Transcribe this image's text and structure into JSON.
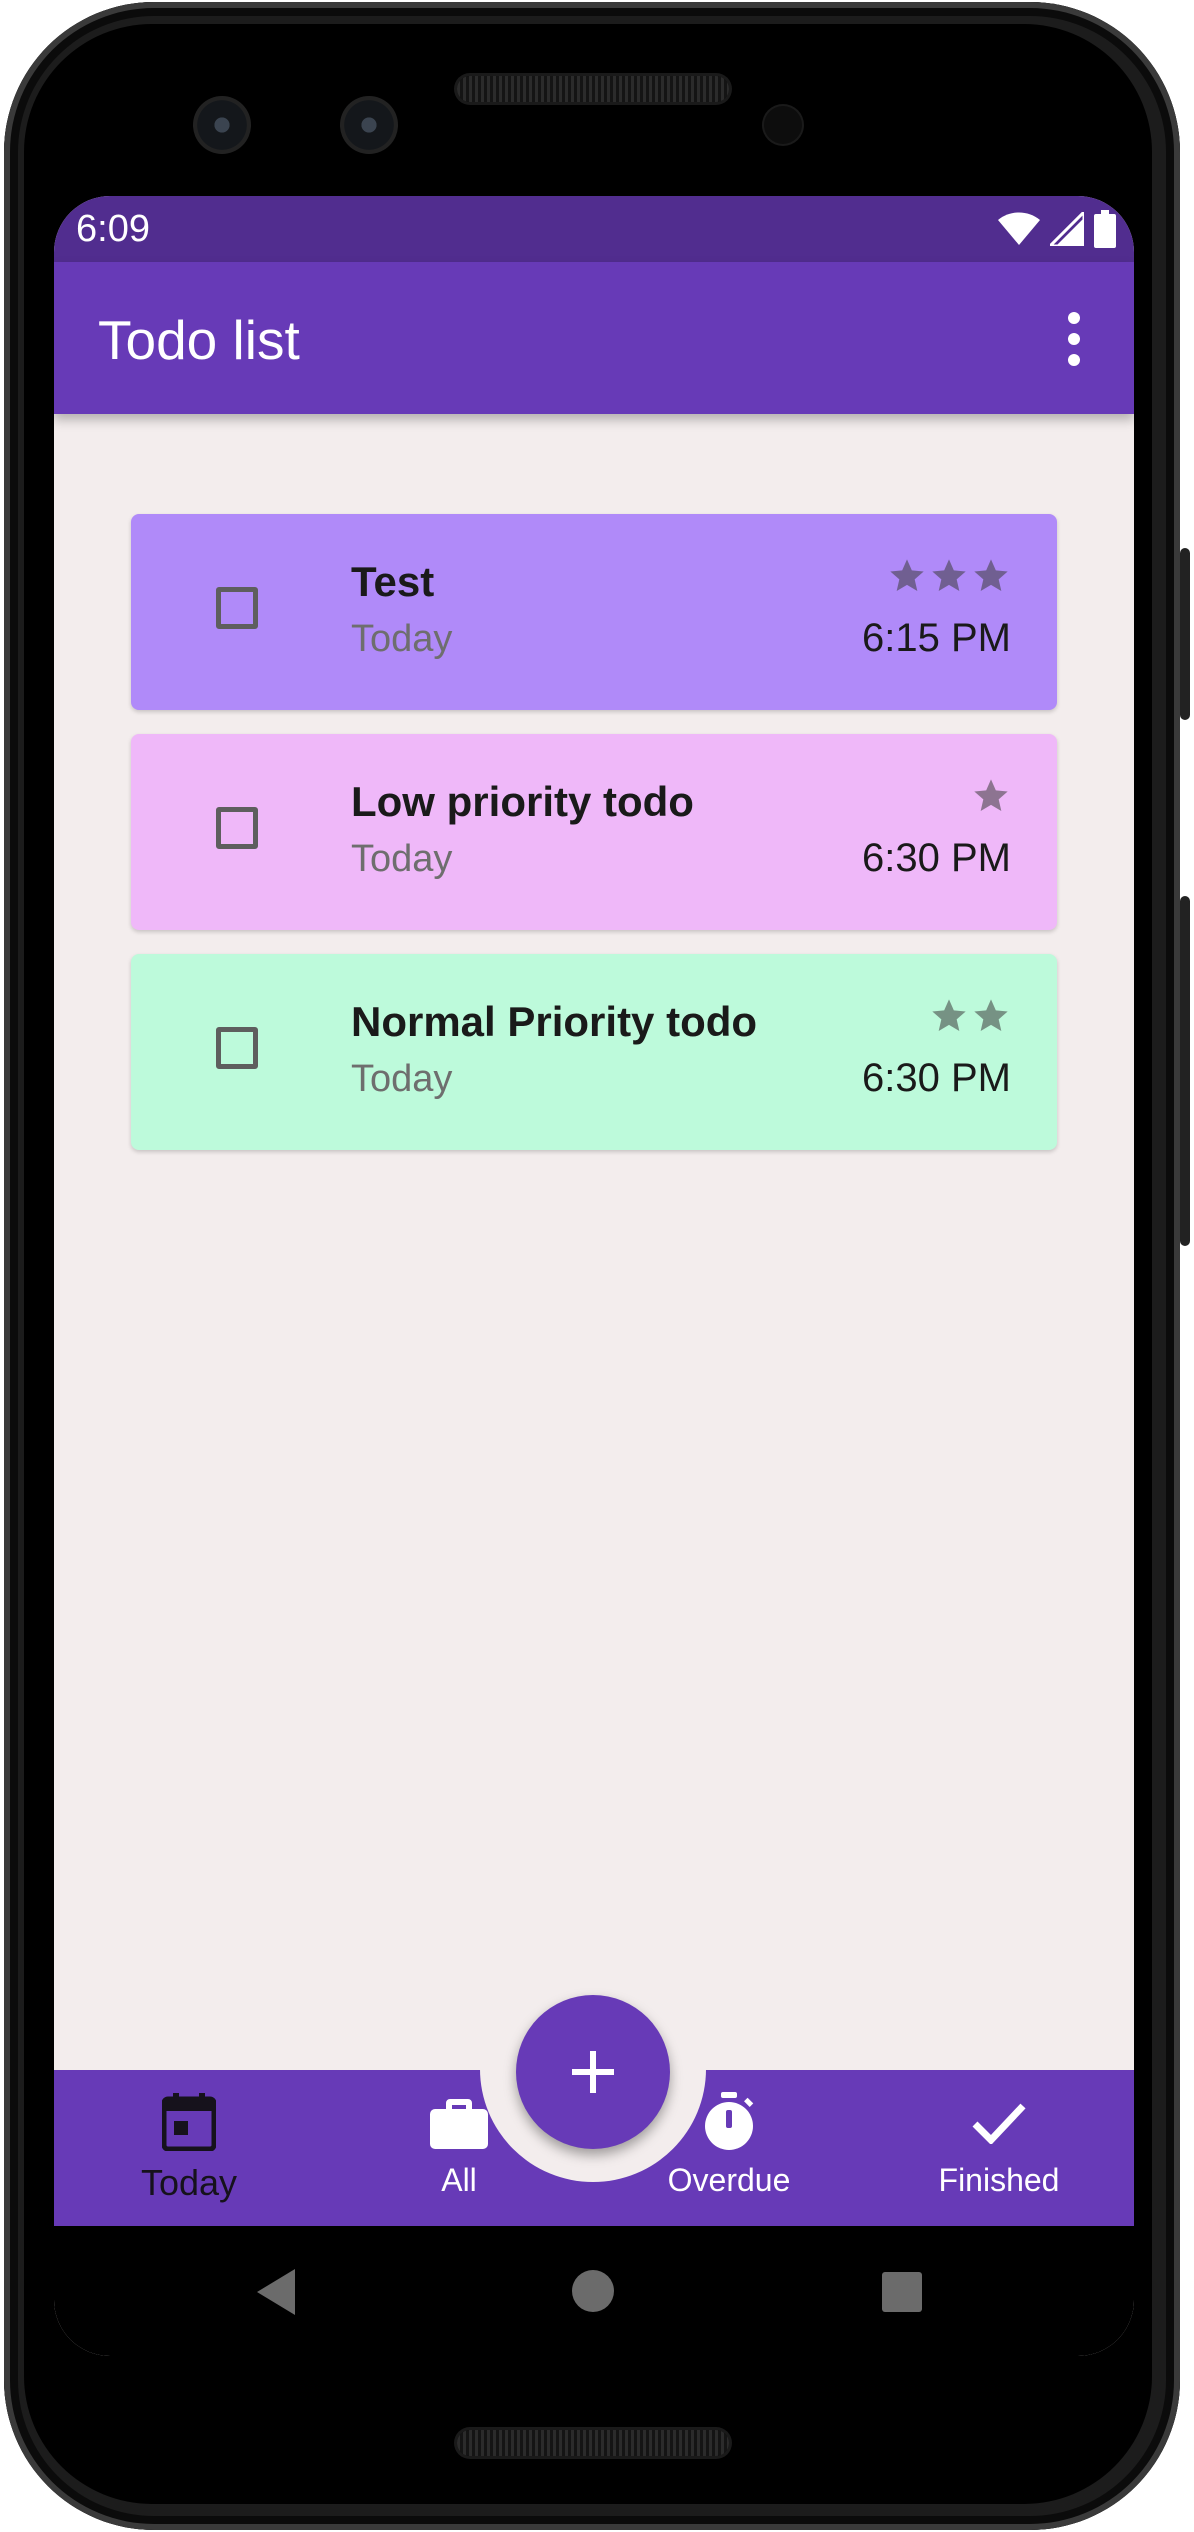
{
  "status_bar": {
    "time": "6:09",
    "icons": [
      "wifi-icon",
      "signal-icon",
      "battery-icon"
    ]
  },
  "app_bar": {
    "title": "Todo list",
    "menu_icon": "more-vert-icon"
  },
  "todos": [
    {
      "title": "Test",
      "date": "Today",
      "time": "6:15 PM",
      "priority_stars": 3,
      "color": "#b08af9",
      "checked": false
    },
    {
      "title": "Low priority todo",
      "date": "Today",
      "time": "6:30 PM",
      "priority_stars": 1,
      "color": "#efb8f9",
      "checked": false
    },
    {
      "title": "Normal Priority todo",
      "date": "Today",
      "time": "6:30 PM",
      "priority_stars": 2,
      "color": "#bdfadb",
      "checked": false
    }
  ],
  "fab": {
    "icon": "plus-icon"
  },
  "bottom_nav": {
    "items": [
      {
        "label": "Today",
        "icon": "calendar-icon",
        "active": true
      },
      {
        "label": "All",
        "icon": "briefcase-icon",
        "active": false
      },
      {
        "label": "Overdue",
        "icon": "timer-icon",
        "active": false
      },
      {
        "label": "Finished",
        "icon": "check-icon",
        "active": false
      }
    ]
  },
  "system_nav": {
    "icons": [
      "back-icon",
      "home-icon",
      "recents-icon"
    ]
  },
  "colors": {
    "primary": "#673ab7",
    "primary_dark": "#512d8f",
    "background": "#f3eded"
  }
}
